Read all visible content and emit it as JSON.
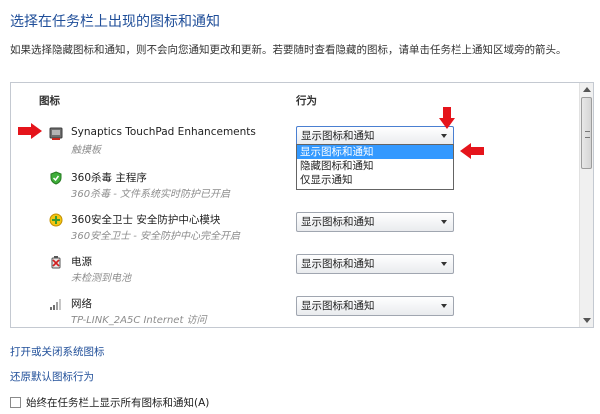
{
  "title": "选择在任务栏上出现的图标和通知",
  "description": "如果选择隐藏图标和通知，则不会向您通知更改和更新。若要随时查看隐藏的图标，请单击任务栏上通知区域旁的箭头。",
  "columns": {
    "icon": "图标",
    "behavior": "行为"
  },
  "rows": [
    {
      "name": "Synaptics TouchPad Enhancements",
      "sub": "触摸板",
      "behavior": "显示图标和通知",
      "icon": "touchpad-icon"
    },
    {
      "name": "360杀毒 主程序",
      "sub": "360杀毒 - 文件系统实时防护已开启",
      "behavior": "",
      "icon": "shield-icon"
    },
    {
      "name": "360安全卫士 安全防护中心模块",
      "sub": "360安全卫士 - 安全防护中心完全开启",
      "behavior": "显示图标和通知",
      "icon": "security-guard-icon"
    },
    {
      "name": "电源",
      "sub": "未检测到电池",
      "behavior": "显示图标和通知",
      "icon": "power-icon"
    },
    {
      "name": "网络",
      "sub": "TP-LINK_2A5C Internet 访问",
      "behavior": "显示图标和通知",
      "icon": "network-icon"
    }
  ],
  "dropdown_options": [
    "显示图标和通知",
    "隐藏图标和通知",
    "仅显示通知"
  ],
  "links": {
    "system_icons": "打开或关闭系统图标",
    "restore": "还原默认图标行为"
  },
  "checkbox_label": "始终在任务栏上显示所有图标和通知(A)",
  "colors": {
    "accent": "#3399ff",
    "link": "#1f4e99",
    "annotation": "#e5141b"
  }
}
